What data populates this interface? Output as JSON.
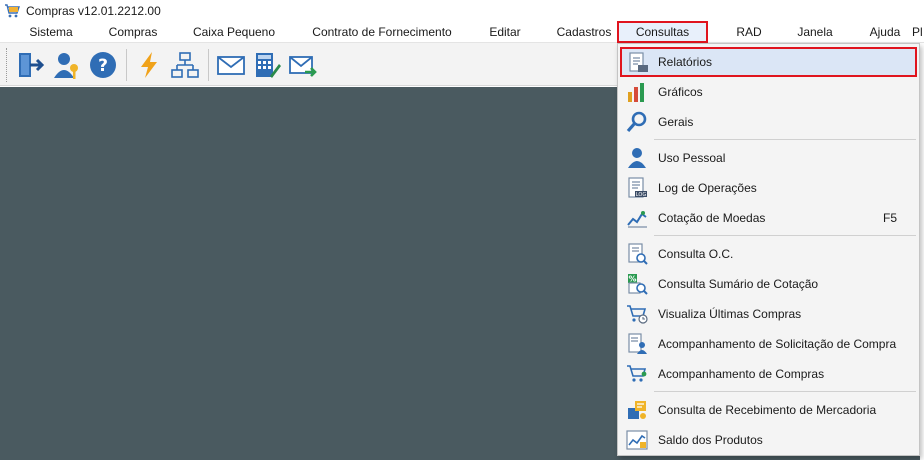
{
  "window": {
    "title": "Compras v12.01.2212.00",
    "app_icon": "cart-icon"
  },
  "menubar": {
    "items": [
      {
        "label": "Sistema"
      },
      {
        "label": "Compras"
      },
      {
        "label": "Caixa Pequeno"
      },
      {
        "label": "Contrato de Fornecimento"
      },
      {
        "label": "Editar"
      },
      {
        "label": "Cadastros"
      },
      {
        "label": "Consultas",
        "active": true
      },
      {
        "label": "RAD"
      },
      {
        "label": "Janela"
      },
      {
        "label": "Ajuda"
      },
      {
        "label": "Pl"
      }
    ]
  },
  "toolbar": {
    "buttons": [
      {
        "icon": "exit-door-icon"
      },
      {
        "icon": "user-key-icon"
      },
      {
        "icon": "help-icon"
      },
      {
        "icon": "lightning-icon"
      },
      {
        "icon": "org-chart-icon"
      },
      {
        "icon": "mail-icon"
      },
      {
        "icon": "calculator-edit-icon"
      },
      {
        "icon": "mail-forward-icon"
      }
    ]
  },
  "dropdown": {
    "items": [
      {
        "label": "Relatórios",
        "icon": "report-icon",
        "highlighted": true
      },
      {
        "label": "Gráficos",
        "icon": "bar-chart-icon"
      },
      {
        "label": "Gerais",
        "icon": "magnifier-icon"
      },
      {
        "separator": true
      },
      {
        "label": "Uso Pessoal",
        "icon": "person-icon"
      },
      {
        "label": "Log de Operações",
        "icon": "log-document-icon"
      },
      {
        "label": "Cotação de Moedas",
        "icon": "currency-trend-icon",
        "shortcut": "F5"
      },
      {
        "separator": true
      },
      {
        "label": "Consulta O.C.",
        "icon": "document-search-icon"
      },
      {
        "label": "Consulta Sumário de Cotação",
        "icon": "percent-search-icon"
      },
      {
        "label": "Visualiza Últimas Compras",
        "icon": "cart-clock-icon"
      },
      {
        "label": "Acompanhamento de Solicitação de Compra",
        "icon": "document-person-icon"
      },
      {
        "label": "Acompanhamento de Compras",
        "icon": "cart-person-icon"
      },
      {
        "separator": true
      },
      {
        "label": "Consulta de Recebimento de Mercadoria",
        "icon": "box-receipt-icon"
      },
      {
        "label": "Saldo dos Produtos",
        "icon": "stock-chart-icon"
      }
    ]
  },
  "colors": {
    "workspace": "#4a5a60",
    "highlight_border": "#e0141e",
    "highlight_fill": "#dbe6f6"
  }
}
